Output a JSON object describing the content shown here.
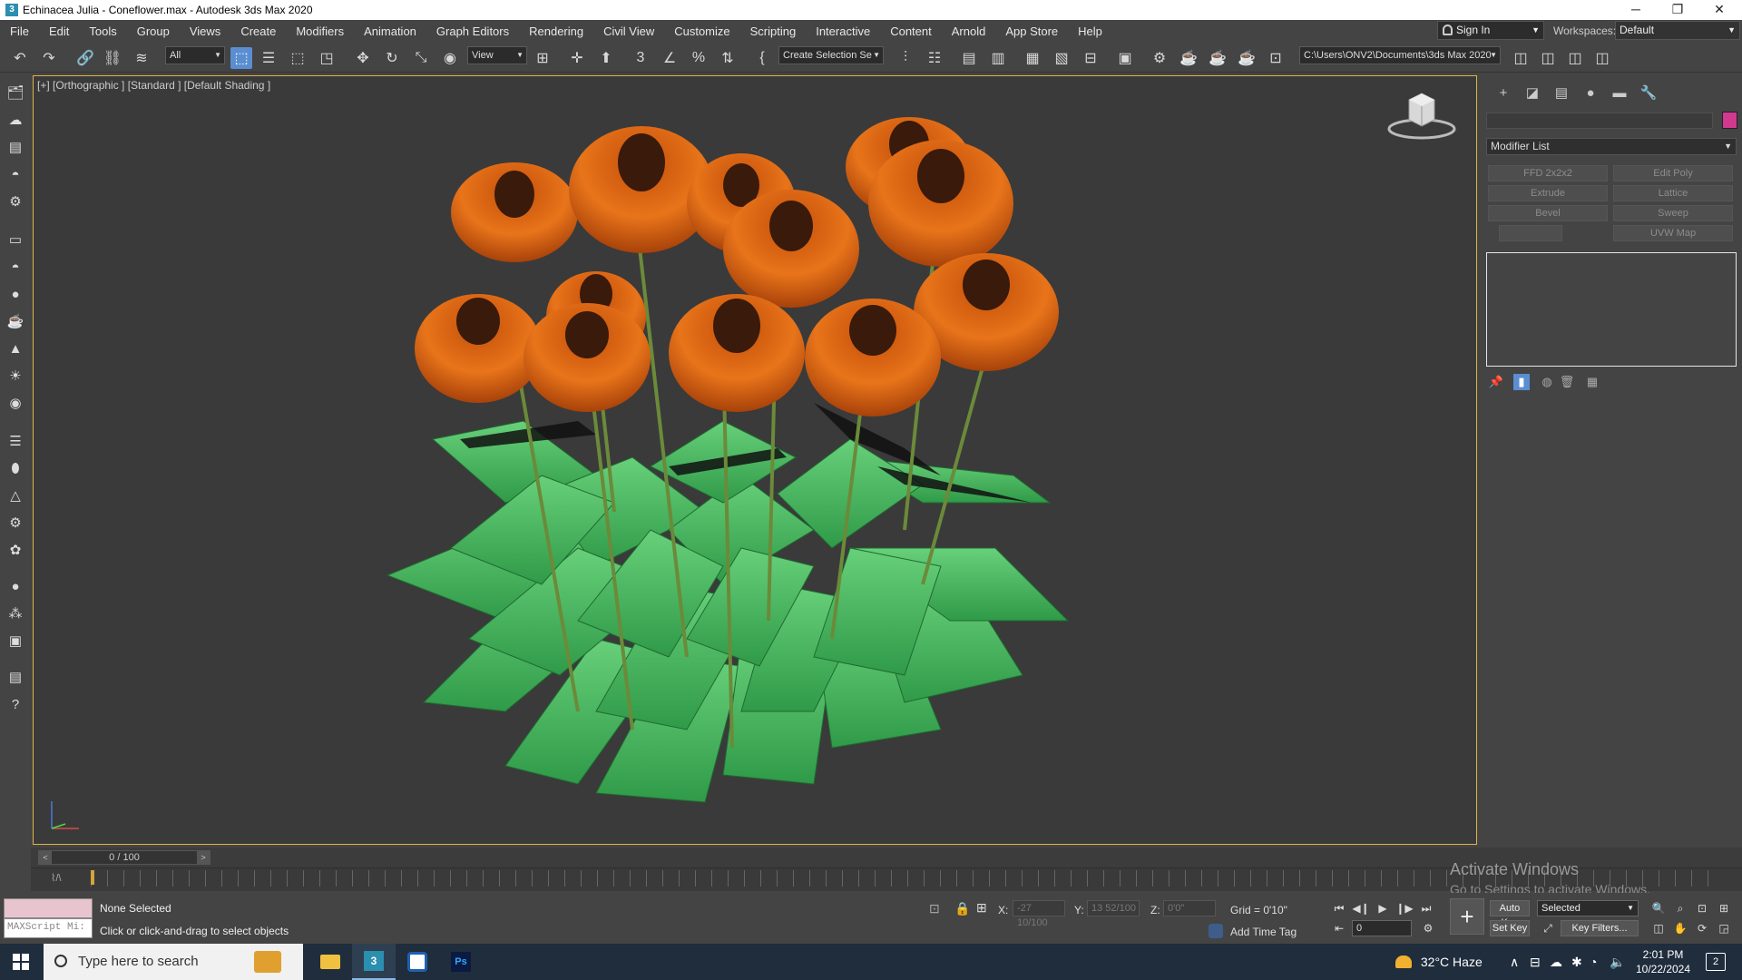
{
  "window": {
    "title": "Echinacea Julia - Coneflower.max - Autodesk 3ds Max 2020"
  },
  "menu": [
    "File",
    "Edit",
    "Tools",
    "Group",
    "Views",
    "Create",
    "Modifiers",
    "Animation",
    "Graph Editors",
    "Rendering",
    "Civil View",
    "Customize",
    "Scripting",
    "Interactive",
    "Content",
    "Arnold",
    "App Store",
    "Help"
  ],
  "account": {
    "sign_in": "Sign In",
    "workspaces_label": "Workspaces:",
    "workspace": "Default"
  },
  "toolbar": {
    "selection_filter": "All",
    "ref_coord": "View",
    "named_selection": "Create Selection Se",
    "project_path": "C:\\Users\\ONV2\\Documents\\3ds Max 2020"
  },
  "viewport": {
    "label": "[+] [Orthographic ] [Standard ] [Default Shading ]"
  },
  "command_panel": {
    "modifier_list": "Modifier List",
    "accent_color": "#d0398f",
    "modifiers": [
      "FFD 2x2x2",
      "Edit Poly",
      "Extrude",
      "Lattice",
      "Bevel",
      "Sweep",
      "",
      "UVW Map"
    ]
  },
  "timeline": {
    "frame_display": "0 / 100"
  },
  "watermark": {
    "line1": "Activate Windows",
    "line2": "Go to Settings to activate Windows."
  },
  "status": {
    "selection": "None Selected",
    "prompt": "Click or click-and-drag to select objects",
    "maxscript": "MAXScript Mi:",
    "x_label": "X:",
    "x_value": "-27 10/100",
    "y_label": "Y:",
    "y_value": "13 52/100",
    "z_label": "Z:",
    "z_value": "0'0\"",
    "grid": "Grid = 0'10\"",
    "add_time_tag": "Add Time Tag",
    "auto_key": "Auto Key",
    "key_mode": "Selected",
    "set_key": "Set Key",
    "key_filters": "Key Filters...",
    "current_frame": "0"
  },
  "taskbar": {
    "search_placeholder": "Type here to search",
    "weather": "32°C  Haze",
    "time": "2:01 PM",
    "date": "10/22/2024",
    "notifications": "2"
  }
}
